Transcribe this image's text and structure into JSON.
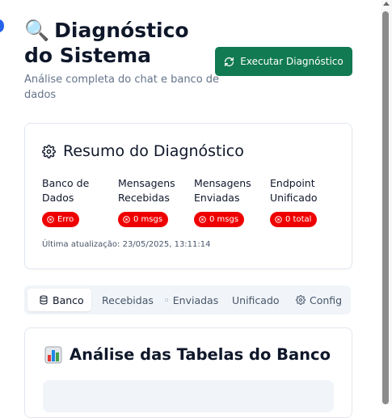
{
  "header": {
    "icon": "magnifier-emoji",
    "title_line1": "Diagnóstico",
    "title_line2": "do Sistema",
    "subtitle": "Análise completa do chat e banco de dados",
    "run_button_label": "Executar Diagnóstico"
  },
  "summary": {
    "title": "Resumo do Diagnóstico",
    "metrics": [
      {
        "label_line1": "Banco de",
        "label_line2": "Dados",
        "badge": "Erro"
      },
      {
        "label_line1": "Mensagens",
        "label_line2": "Recebidas",
        "badge": "0 msgs"
      },
      {
        "label_line1": "Mensagens",
        "label_line2": "Enviadas",
        "badge": "0 msgs"
      },
      {
        "label_line1": "Endpoint",
        "label_line2": "Unificado",
        "badge": "0 total"
      }
    ],
    "updated": "Última atualização: 23/05/2025, 13:11:14"
  },
  "tabs": [
    {
      "label": "Banco",
      "active": true
    },
    {
      "label": "Recebidas",
      "active": false
    },
    {
      "label": "Enviadas",
      "active": false
    },
    {
      "label": "Unificado",
      "active": false
    },
    {
      "label": "Config",
      "active": false
    }
  ],
  "analysis": {
    "title": "Análise das Tabelas do Banco"
  },
  "colors": {
    "primary_button": "#117a52",
    "error_badge": "#ef0000",
    "muted_text": "#64748b"
  }
}
